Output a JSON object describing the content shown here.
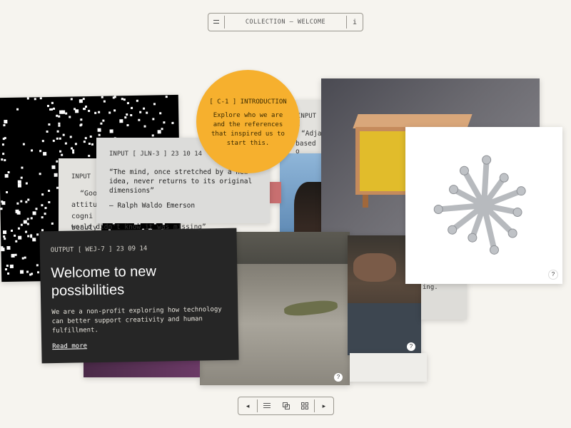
{
  "topbar": {
    "menu_icon": "menu-icon",
    "title": "COLLECTION — WELCOME",
    "info_label": "i"
  },
  "cards": {
    "circle": {
      "header": "[ C-1 ] INTRODUCTION",
      "text": "Explore who we are and the references that inspired us to start this."
    },
    "quote": {
      "header": "INPUT [ JLN-3 ] 23 10 14",
      "body": "“The mind, once stretched by a new idea, never returns to its original dimensions”",
      "author": "– Ralph Waldo Emerson"
    },
    "left_input": {
      "header": "INPUT",
      "lines": [
        "“Goo",
        "attitu",
        "cogni",
        "beauty",
        "world didn't know it was missing”"
      ]
    },
    "right_input": {
      "header": "INPUT [",
      "lines": [
        "“Adja",
        "based o"
      ]
    },
    "right_fragment": {
      "text": "ing."
    },
    "output": {
      "header": "OUTPUT [ WEJ-7 ] 23 09 14",
      "title": "Welcome to new possibilities",
      "description": "We are a non-profit exploring how technology can better support creativity and human fulfillment.",
      "link": "Read more"
    },
    "help_marker": "?"
  },
  "bottombar": {
    "prev": "◂",
    "next": "▸",
    "list_icon": "list-view-icon",
    "stack_icon": "stack-view-icon",
    "grid_icon": "grid-view-icon"
  }
}
